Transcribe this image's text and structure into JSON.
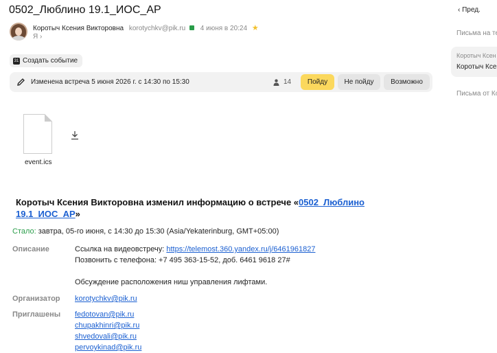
{
  "message": {
    "subject": "0502_Люблино 19.1_ИОС_АР",
    "sender_name": "Коротыч Ксения Викторовна",
    "sender_email": "korotychkv@pik.ru",
    "date": "4 июня в 20:24",
    "to": "Я ›"
  },
  "toolbar": {
    "create_event": "Создать событие"
  },
  "event": {
    "changed_text": "Изменена встреча 5 июня 2026 г. с 14:30 по 15:30",
    "attendees_count": "14",
    "btn_go": "Пойду",
    "btn_no": "Не пойду",
    "btn_maybe": "Возможно"
  },
  "attachment": {
    "file_name": "event.ics"
  },
  "body": {
    "headline_prefix": "Коротыч Ксения Викторовна изменил информацию о встрече «",
    "headline_link": "0502_Люблино 19.1_ИОС_АР",
    "headline_suffix": "»",
    "stalo_label": "Стало:",
    "stalo_value": "завтра, 05-го июня, с 14:30 до 15:30 (Asia/Yekaterinburg, GMT+05:00)",
    "desc_label": "Описание",
    "desc_line1_prefix": "Ссылка на видеовстречу: ",
    "desc_link": "https://telemost.360.yandex.ru/j/6461961827",
    "desc_line2": "Позвонить с телефона: +7 495 363-15-52, доб. 6461 9618 27#",
    "desc_line3": "Обсуждение расположения ниш управления лифтами.",
    "org_label": "Организатор",
    "org_email": "korotychkv@pik.ru",
    "invited_label": "Приглашены",
    "invited": [
      "fedotovan@pik.ru",
      "chupakhinri@pik.ru",
      "shvedovali@pik.ru",
      "pervoykinad@pik.ru"
    ]
  },
  "sidebar": {
    "prev": "‹  Пред.",
    "item1": "Письма на те",
    "sel_line1": "Коротыч Ксен",
    "sel_line2": "Коротыч Ксен",
    "item3": "Письма от Ко"
  },
  "colors": {
    "accent_yellow": "#fbd85d",
    "link": "#1a5fd1",
    "green": "#2a9d4a"
  }
}
